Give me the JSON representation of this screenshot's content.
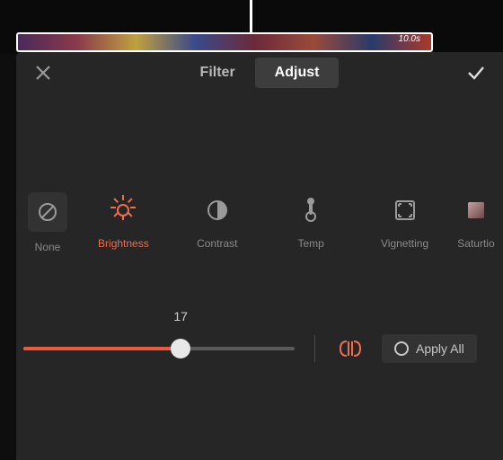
{
  "timeline": {
    "clip_duration": "10.0s"
  },
  "tabs": {
    "filter": "Filter",
    "adjust": "Adjust",
    "active": "adjust"
  },
  "adjustments": [
    {
      "key": "none",
      "label": "None"
    },
    {
      "key": "brightness",
      "label": "Brightness"
    },
    {
      "key": "contrast",
      "label": "Contrast"
    },
    {
      "key": "temp",
      "label": "Temp"
    },
    {
      "key": "vignetting",
      "label": "Vignetting"
    },
    {
      "key": "saturation",
      "label": "Saturtio"
    }
  ],
  "selected_adjustment": "brightness",
  "slider": {
    "value": 17,
    "min": -50,
    "max": 50,
    "fill_percent": 58
  },
  "apply_all_label": "Apply All",
  "colors": {
    "accent": "#ef6e4e",
    "slider_fill": "#ef5a3c",
    "panel": "#262627"
  }
}
